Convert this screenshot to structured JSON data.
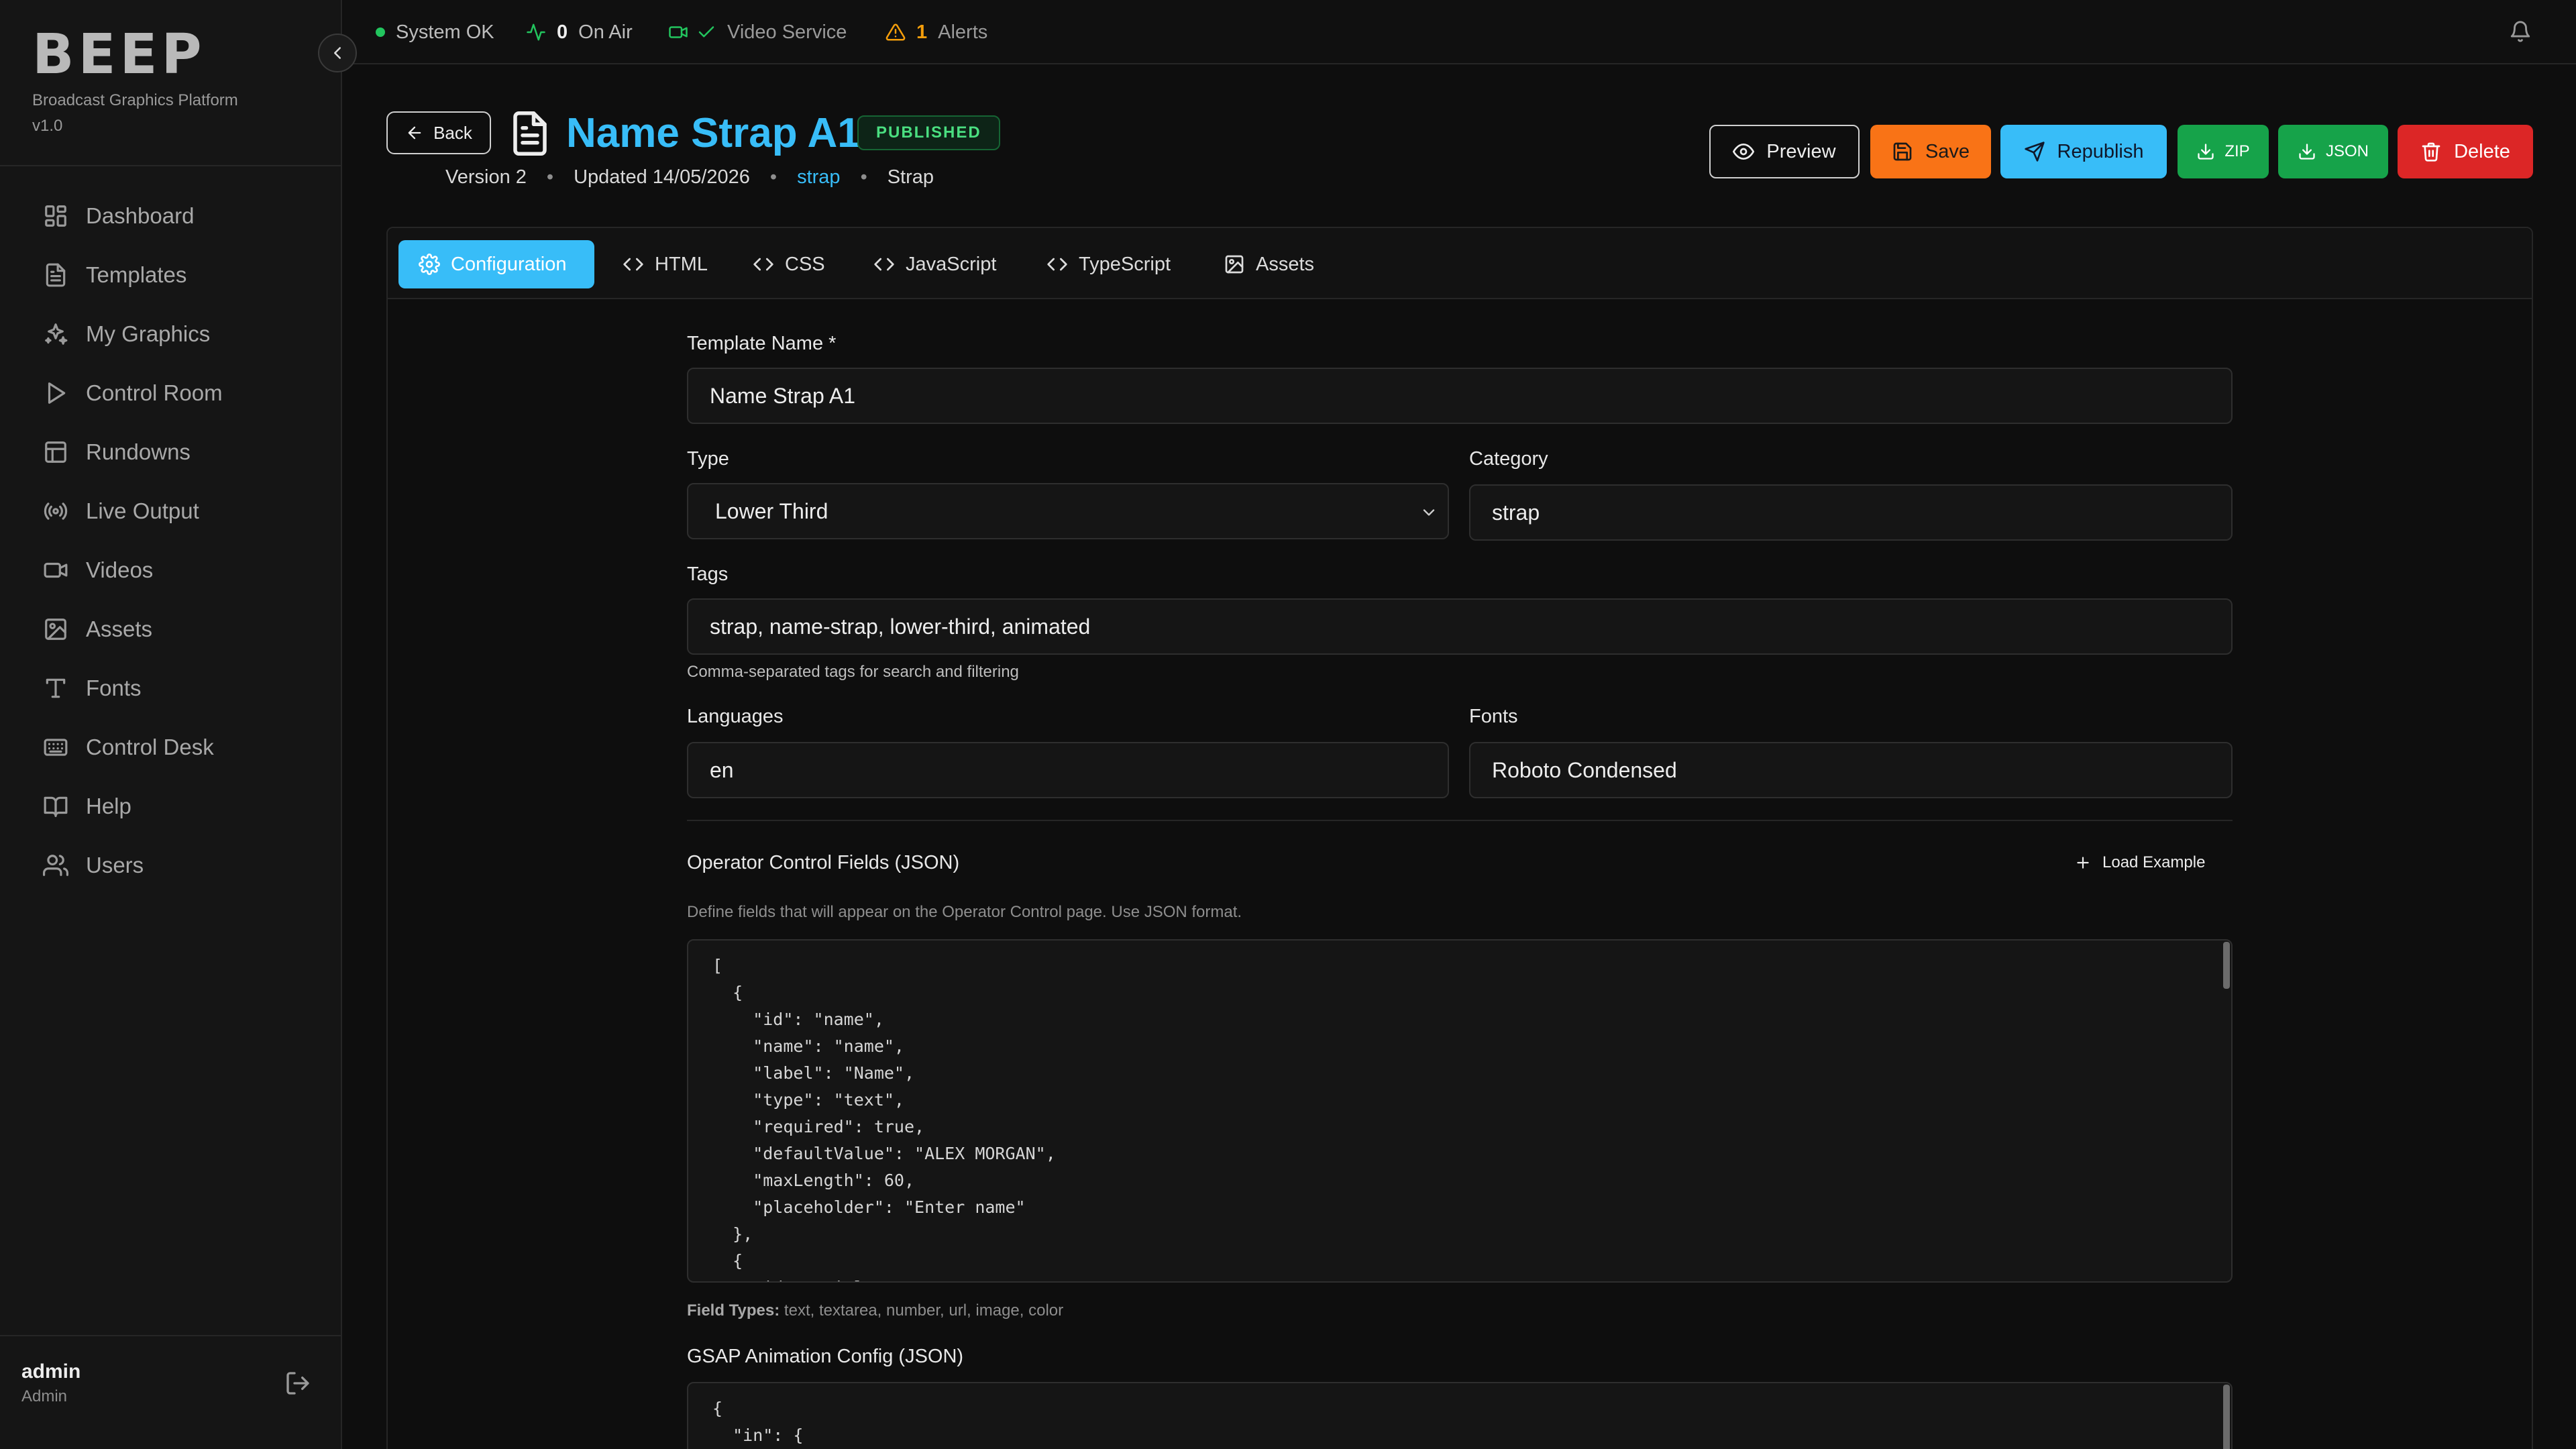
{
  "brand": {
    "logo": "BEEP",
    "subtitle": "Broadcast Graphics Platform",
    "version": "v1.0"
  },
  "sidebar": {
    "items": [
      {
        "label": "Dashboard",
        "icon": "dashboard-icon"
      },
      {
        "label": "Templates",
        "icon": "file-text-icon"
      },
      {
        "label": "My Graphics",
        "icon": "sparkles-icon"
      },
      {
        "label": "Control Room",
        "icon": "play-icon"
      },
      {
        "label": "Rundowns",
        "icon": "table-icon"
      },
      {
        "label": "Live Output",
        "icon": "broadcast-icon"
      },
      {
        "label": "Videos",
        "icon": "video-icon"
      },
      {
        "label": "Assets",
        "icon": "image-icon"
      },
      {
        "label": "Fonts",
        "icon": "type-icon"
      },
      {
        "label": "Control Desk",
        "icon": "keyboard-icon"
      },
      {
        "label": "Help",
        "icon": "book-icon"
      },
      {
        "label": "Users",
        "icon": "users-icon"
      }
    ],
    "user": {
      "name": "admin",
      "role": "Admin"
    }
  },
  "topbar": {
    "system_status": "System OK",
    "on_air_count": "0",
    "on_air_label": "On Air",
    "video_service_label": "Video Service",
    "alerts_count": "1",
    "alerts_label": "Alerts"
  },
  "header": {
    "back_label": "Back",
    "title": "Name Strap A1",
    "status": "PUBLISHED",
    "version": "Version 2",
    "updated": "Updated 14/05/2026",
    "category_link": "strap",
    "type_label": "Strap",
    "buttons": {
      "preview": "Preview",
      "save": "Save",
      "republish": "Republish",
      "zip": "ZIP",
      "json": "JSON",
      "delete": "Delete"
    }
  },
  "tabs": [
    {
      "label": "Configuration",
      "icon": "gear-icon",
      "active": true
    },
    {
      "label": "HTML",
      "icon": "code-icon"
    },
    {
      "label": "CSS",
      "icon": "code-icon"
    },
    {
      "label": "JavaScript",
      "icon": "code-icon"
    },
    {
      "label": "TypeScript",
      "icon": "code-icon"
    },
    {
      "label": "Assets",
      "icon": "image-icon"
    }
  ],
  "form": {
    "template_name_label": "Template Name *",
    "template_name": "Name Strap A1",
    "type_label": "Type",
    "type_value": "Lower Third",
    "category_label": "Category",
    "category_value": "strap",
    "tags_label": "Tags",
    "tags_value": "strap, name-strap, lower-third, animated",
    "tags_help": "Comma-separated tags for search and filtering",
    "languages_label": "Languages",
    "languages_value": "en",
    "fonts_label": "Fonts",
    "fonts_value": "Roboto Condensed",
    "operator_fields_label": "Operator Control Fields (JSON)",
    "load_example": "Load Example",
    "operator_fields_help": "Define fields that will appear on the Operator Control page. Use JSON format.",
    "operator_fields_code": "[\n  {\n    \"id\": \"name\",\n    \"name\": \"name\",\n    \"label\": \"Name\",\n    \"type\": \"text\",\n    \"required\": true,\n    \"defaultValue\": \"ALEX MORGAN\",\n    \"maxLength\": 60,\n    \"placeholder\": \"Enter name\"\n  },\n  {\n    \"id\": \"title\",",
    "field_types_label": "Field Types:",
    "field_types_value": "text, textarea, number, url, image, color",
    "gsap_label": "GSAP Animation Config (JSON)",
    "gsap_code": "{\n  \"in\": {"
  },
  "colors": {
    "accent": "#38bdf8",
    "save": "#f97316",
    "export": "#16a34a",
    "delete": "#dc2626",
    "status_ok": "#22c55e",
    "alert": "#f59e0b"
  }
}
